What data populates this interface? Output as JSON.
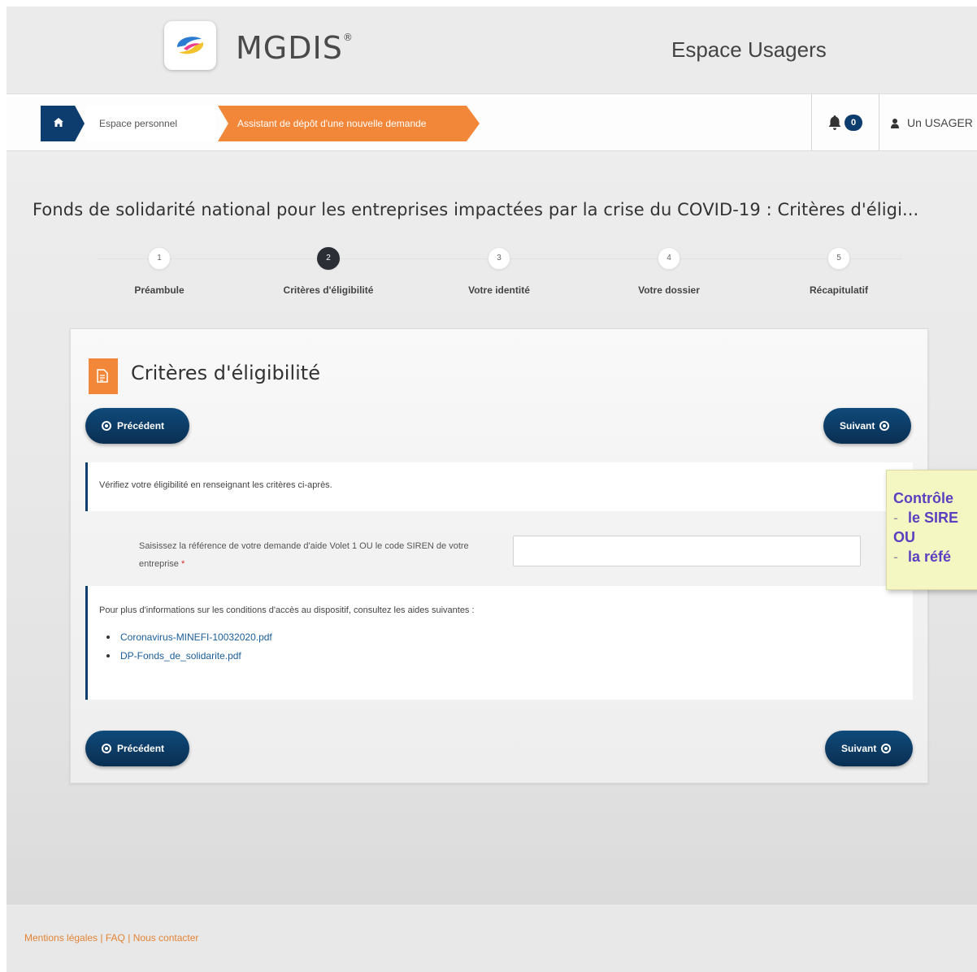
{
  "header": {
    "brand": "MGDIS",
    "brand_mark": "®",
    "title": "Espace Usagers"
  },
  "breadcrumb": {
    "home_icon": "home-icon",
    "personal": "Espace personnel",
    "current": "Assistant de dépôt d'une nouvelle demande"
  },
  "toolbar": {
    "notification_count": "0",
    "user_name": "Un USAGER"
  },
  "page": {
    "title": "Fonds de solidarité national pour les entreprises impactées par la crise du COVID-19 : Critères d'éligi..."
  },
  "steps": [
    {
      "number": "1",
      "label": "Préambule"
    },
    {
      "number": "2",
      "label": "Critères d'éligibilité",
      "active": true
    },
    {
      "number": "3",
      "label": "Votre identité"
    },
    {
      "number": "4",
      "label": "Votre dossier"
    },
    {
      "number": "5",
      "label": "Récapitulatif"
    }
  ],
  "card": {
    "title": "Critères d'éligibilité",
    "prev_label": "Précédent",
    "next_label": "Suivant",
    "intro": "Vérifiez votre éligibilité en renseignant les critères ci-après.",
    "field_label": "Saisissez la référence de votre demande d'aide Volet 1 OU le code SIREN de votre entreprise",
    "field_required": "*",
    "field_value": "",
    "info_text": "Pour plus d'informations sur les conditions d'accès au dispositif, consultez les aides suivantes :",
    "links": [
      "Coronavirus-MINEFI-10032020.pdf",
      "DP-Fonds_de_solidarite.pdf"
    ]
  },
  "note": {
    "line1": "Contrôle",
    "line2_dash": "-",
    "line2": "le SIRE",
    "line3": "OU",
    "line4_dash": "-",
    "line4": "la réfé"
  },
  "footer": {
    "links": [
      "Mentions légales",
      "FAQ",
      "Nous contacter"
    ],
    "separator": "|"
  },
  "colors": {
    "primary": "#0d3c6e",
    "accent": "#f2873a",
    "link": "#1a5d99",
    "note_bg": "#f5f7c2",
    "note_text": "#5a3fc0"
  }
}
